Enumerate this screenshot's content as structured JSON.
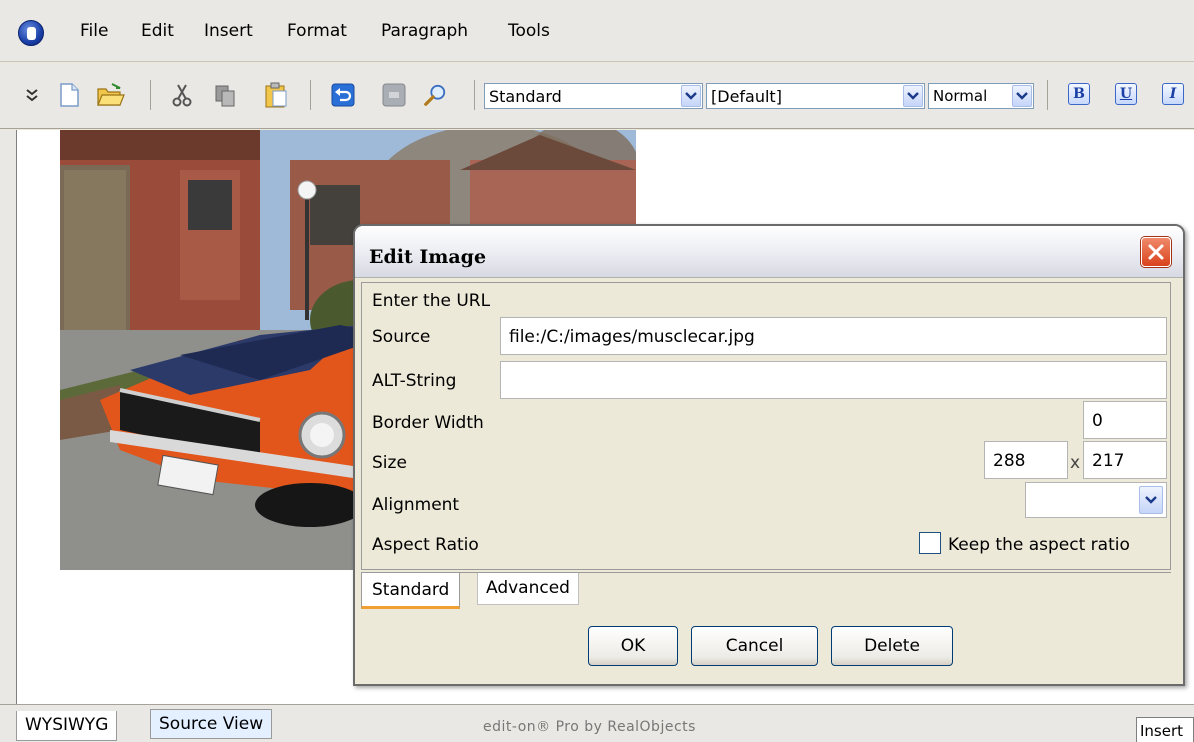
{
  "menu": {
    "items": [
      "File",
      "Edit",
      "Insert",
      "Format",
      "Paragraph",
      "Tools"
    ]
  },
  "toolbar": {
    "icons": [
      "chevron-double-down-icon",
      "new-document-icon",
      "open-folder-icon",
      "cut-icon",
      "copy-icon",
      "paste-icon",
      "undo-icon",
      "redo-icon",
      "find-icon"
    ],
    "paragraph_style": "Standard",
    "font_family": "[Default]",
    "font_size": "Normal",
    "format_buttons": [
      {
        "icon": "bold-icon",
        "glyph": "B"
      },
      {
        "icon": "underline-icon",
        "glyph": "U"
      },
      {
        "icon": "italic-icon",
        "glyph": "I"
      }
    ]
  },
  "dialog": {
    "title": "Edit Image",
    "section_label": "Enter the URL",
    "source": {
      "label": "Source",
      "value": "file:/C:/images/musclecar.jpg"
    },
    "alt": {
      "label": "ALT-String",
      "value": ""
    },
    "border_width": {
      "label": "Border Width",
      "value": "0"
    },
    "size": {
      "label": "Size",
      "width": "288",
      "separator": "x",
      "height": "217"
    },
    "alignment": {
      "label": "Alignment",
      "value": ""
    },
    "aspect_ratio": {
      "label": "Aspect Ratio",
      "checkbox_label": "Keep the aspect ratio",
      "checked": false
    },
    "tabs": [
      "Standard",
      "Advanced"
    ],
    "buttons": {
      "ok": "OK",
      "cancel": "Cancel",
      "delete": "Delete"
    }
  },
  "statusbar": {
    "view_tabs": [
      "WYSIWYG",
      "Source View"
    ],
    "brand": "edit-on® Pro by RealObjects",
    "mode": "Insert"
  },
  "colors": {
    "accent": "#3b68c8",
    "close_button": "#d9421c",
    "tab_highlight": "#f0a030",
    "car_body": "#e2561c"
  }
}
